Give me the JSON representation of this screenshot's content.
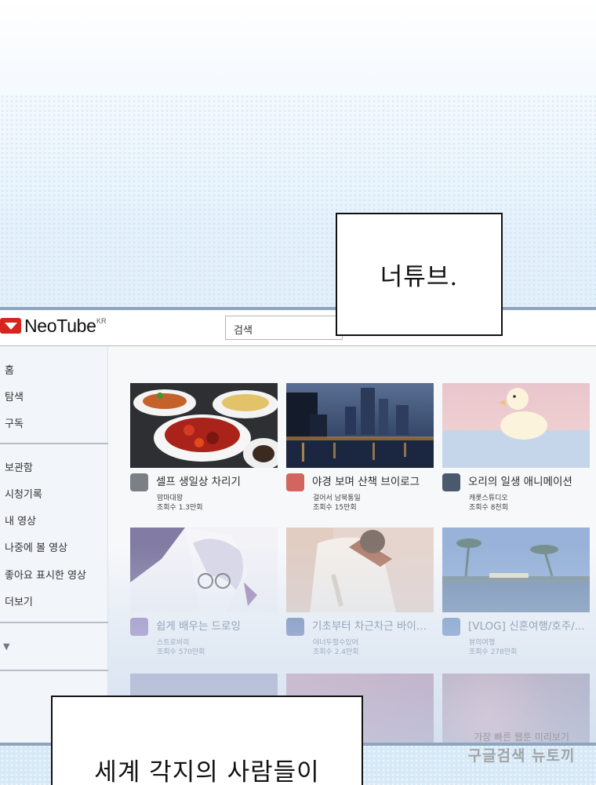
{
  "caption_top": "너튜브.",
  "caption_bottom": "세계 각지의 사람들이",
  "app": {
    "logo": "NeoTube",
    "region": "KR",
    "search_placeholder": "검색"
  },
  "sidebar": {
    "group1": [
      "홈",
      "탐색",
      "구독"
    ],
    "group2": [
      "보관함",
      "시청기록",
      "내 영상",
      "나중에 볼 영상",
      "좋아요 표시한 영상",
      "더보기"
    ],
    "expand_icon": "chevron-down-icon"
  },
  "videos": [
    {
      "title": "셀프 생일상 차리기",
      "channel": "맘마대왕",
      "views": "조회수 1.3만회"
    },
    {
      "title": "야경 보며 산책 브이로그",
      "channel": "걸어서 남북통일",
      "views": "조회수 15만회"
    },
    {
      "title": "오리의 일생 애니메이션",
      "channel": "캐롯스튜디오",
      "views": "조회수 8천회"
    },
    {
      "title": "쉽게 배우는 드로잉",
      "channel": "스트로비리",
      "views": "조회수 570만회"
    },
    {
      "title": "기초부터 차근차근 바이올...",
      "channel": "야너두할수있어",
      "views": "조회수 2.4만회"
    },
    {
      "title": "[VLOG] 신혼여행/호주/...",
      "channel": "뷰의여행",
      "views": "조회수 278만회"
    }
  ],
  "watermark": {
    "line1": "가장 빠른 웹툰 미리보기",
    "line2": "구글검색 뉴토끼"
  },
  "colors": {
    "logo_red": "#d8241c",
    "frame_blue": "#8ea6bd",
    "sidebar_bg": "#f2f5fa"
  }
}
